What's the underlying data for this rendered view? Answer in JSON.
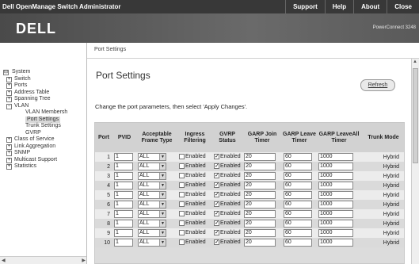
{
  "topbar": {
    "title": "Dell OpenManage Switch Administrator",
    "menu": [
      "Support",
      "Help",
      "About",
      "Close"
    ]
  },
  "brand": {
    "logo": "DELL",
    "product": "PowerConnect 3248"
  },
  "breadcrumb": "Port Settings",
  "sidebar": {
    "items": [
      {
        "label": "System",
        "box": "⊟"
      },
      {
        "label": "Switch",
        "box": "+"
      },
      {
        "label": "Ports",
        "box": "+"
      },
      {
        "label": "Address Table",
        "box": "+"
      },
      {
        "label": "Spanning Tree",
        "box": "+"
      },
      {
        "label": "VLAN",
        "box": "−"
      },
      {
        "label": "VLAN Membersh",
        "box": ""
      },
      {
        "label": "Port Settings",
        "box": ""
      },
      {
        "label": "Trunk Settings",
        "box": ""
      },
      {
        "label": "GVRP",
        "box": ""
      },
      {
        "label": "Class of Service",
        "box": "+"
      },
      {
        "label": "Link Aggregation",
        "box": "+"
      },
      {
        "label": "SNMP",
        "box": "+"
      },
      {
        "label": "Multicast Support",
        "box": "+"
      },
      {
        "label": "Statistics",
        "box": "+"
      }
    ]
  },
  "main": {
    "title": "Port Settings",
    "refresh_label": "Refresh",
    "instruction": "Change the port parameters, then select 'Apply Changes'.",
    "columns": [
      "Port",
      "PVID",
      "Acceptable Frame Type",
      "Ingress Filtering",
      "GVRP Status",
      "GARP Join Timer",
      "GARP Leave Timer",
      "GARP LeaveAll Timer",
      "Trunk Mode"
    ],
    "enabled_label": "Enabled",
    "rows": [
      {
        "port": "1",
        "pvid": "1",
        "frame": "ALL",
        "ingress": false,
        "gvrp": true,
        "join": "20",
        "leave": "60",
        "leaveall": "1000",
        "mode": "Hybrid"
      },
      {
        "port": "2",
        "pvid": "1",
        "frame": "ALL",
        "ingress": false,
        "gvrp": true,
        "join": "20",
        "leave": "60",
        "leaveall": "1000",
        "mode": "Hybrid"
      },
      {
        "port": "3",
        "pvid": "1",
        "frame": "ALL",
        "ingress": false,
        "gvrp": true,
        "join": "20",
        "leave": "60",
        "leaveall": "1000",
        "mode": "Hybrid"
      },
      {
        "port": "4",
        "pvid": "1",
        "frame": "ALL",
        "ingress": false,
        "gvrp": true,
        "join": "20",
        "leave": "60",
        "leaveall": "1000",
        "mode": "Hybrid"
      },
      {
        "port": "5",
        "pvid": "1",
        "frame": "ALL",
        "ingress": false,
        "gvrp": true,
        "join": "20",
        "leave": "60",
        "leaveall": "1000",
        "mode": "Hybrid"
      },
      {
        "port": "6",
        "pvid": "1",
        "frame": "ALL",
        "ingress": false,
        "gvrp": true,
        "join": "20",
        "leave": "60",
        "leaveall": "1000",
        "mode": "Hybrid"
      },
      {
        "port": "7",
        "pvid": "1",
        "frame": "ALL",
        "ingress": false,
        "gvrp": true,
        "join": "20",
        "leave": "60",
        "leaveall": "1000",
        "mode": "Hybrid"
      },
      {
        "port": "8",
        "pvid": "1",
        "frame": "ALL",
        "ingress": false,
        "gvrp": true,
        "join": "20",
        "leave": "60",
        "leaveall": "1000",
        "mode": "Hybrid"
      },
      {
        "port": "9",
        "pvid": "1",
        "frame": "ALL",
        "ingress": false,
        "gvrp": true,
        "join": "20",
        "leave": "60",
        "leaveall": "1000",
        "mode": "Hybrid"
      },
      {
        "port": "10",
        "pvid": "1",
        "frame": "ALL",
        "ingress": false,
        "gvrp": true,
        "join": "20",
        "leave": "60",
        "leaveall": "1000",
        "mode": "Hybrid"
      }
    ]
  }
}
